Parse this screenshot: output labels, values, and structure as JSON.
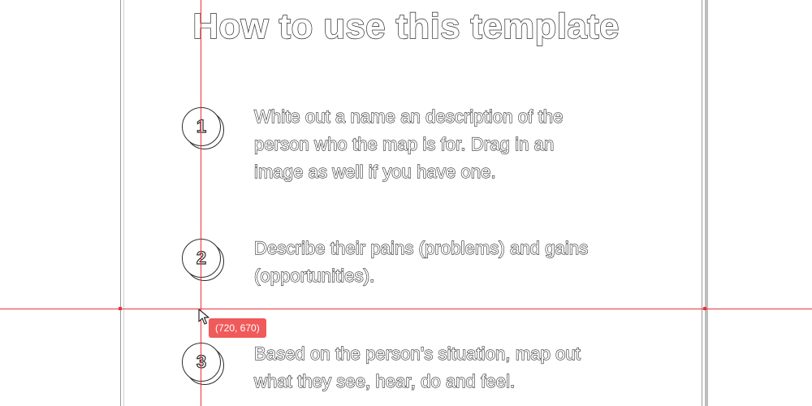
{
  "title": "How to use this template",
  "steps": [
    {
      "number": "1",
      "lines": [
        "White out a name an description of the",
        "person who the map is for. Drag in an",
        "image as well if you have one."
      ]
    },
    {
      "number": "2",
      "lines": [
        "Describe their pains (problems) and gains",
        "(opportunities)."
      ]
    },
    {
      "number": "3",
      "lines": [
        "Based on the person's situation, map out",
        "what they see, hear, do and feel."
      ]
    }
  ],
  "cursor_readout": "(720, 670)",
  "colors": {
    "guide": "#e8323c",
    "tooltip": "#f05a5a",
    "stroke": "#2b2b2b"
  }
}
